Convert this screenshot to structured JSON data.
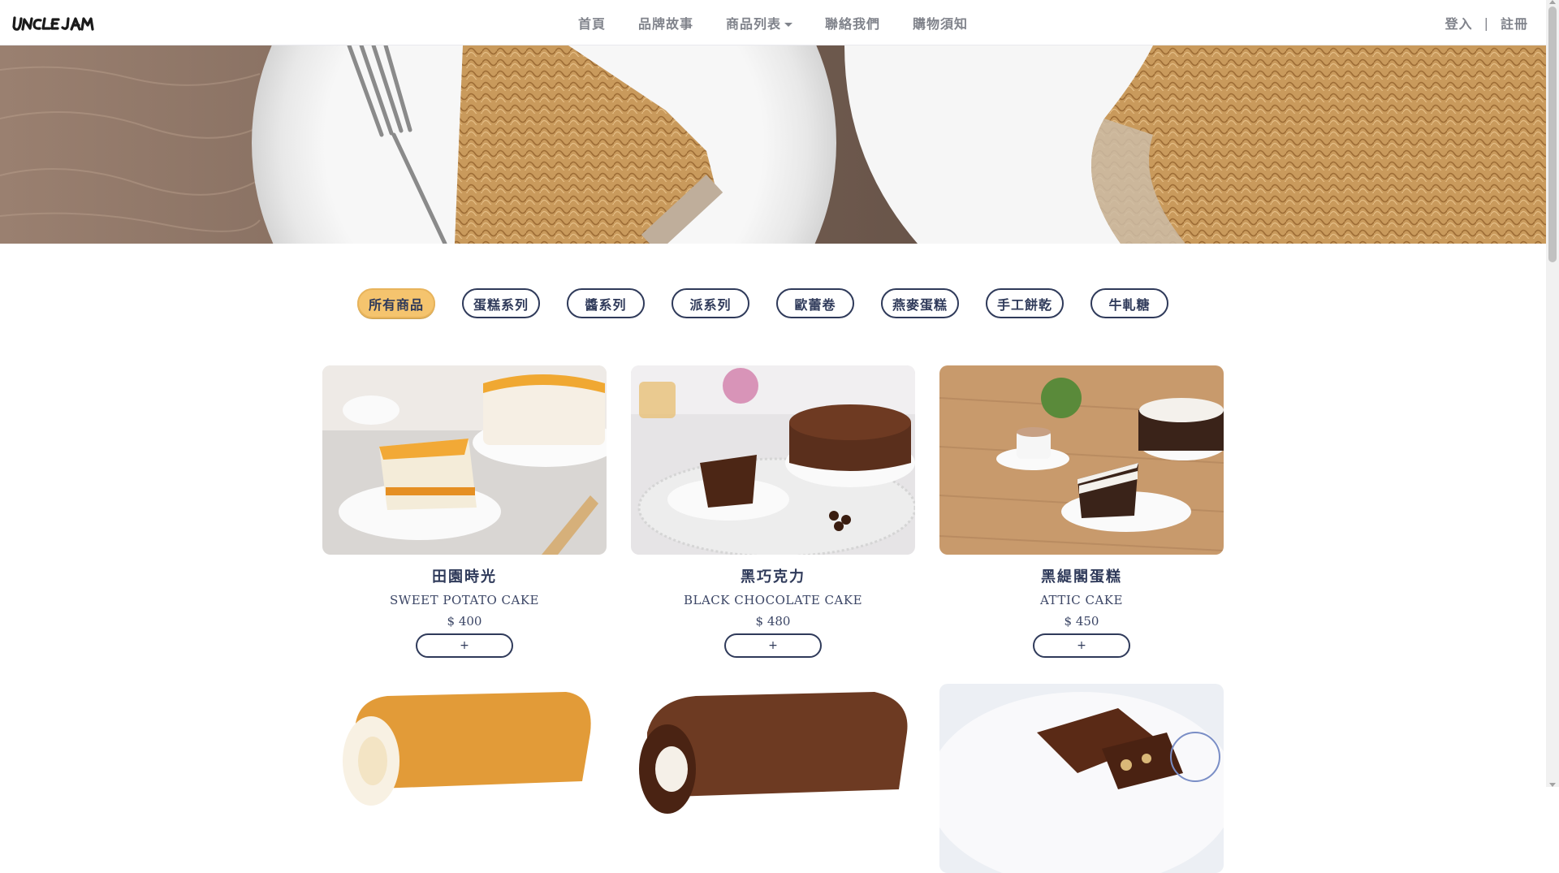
{
  "brand": {
    "logo_text": "UNCLE JAM"
  },
  "nav": {
    "items": [
      {
        "label": "首頁"
      },
      {
        "label": "品牌故事"
      },
      {
        "label": "商品列表"
      },
      {
        "label": "聯絡我們"
      },
      {
        "label": "購物須知"
      }
    ]
  },
  "auth": {
    "login": "登入",
    "separator": "|",
    "register": "註冊"
  },
  "filters": [
    {
      "label": "所有商品",
      "active": true
    },
    {
      "label": "蛋糕系列"
    },
    {
      "label": "醬系列"
    },
    {
      "label": "派系列"
    },
    {
      "label": "歐蕾卷"
    },
    {
      "label": "燕麥蛋糕"
    },
    {
      "label": "手工餅乾"
    },
    {
      "label": "牛軋糖"
    }
  ],
  "products": [
    {
      "name": "田園時光",
      "sub": "SWEET POTATO CAKE",
      "price": "$ 400",
      "add": "+"
    },
    {
      "name": "黑巧克力",
      "sub": "BLACK CHOCOLATE CAKE",
      "price": "$ 480",
      "add": "+"
    },
    {
      "name": "黑緹閣蛋糕",
      "sub": "ATTIC CAKE",
      "price": "$ 450",
      "add": "+"
    }
  ],
  "colors": {
    "accent": "#f5c46e",
    "navy": "#2f3a5a",
    "nav_text": "#80838b"
  }
}
